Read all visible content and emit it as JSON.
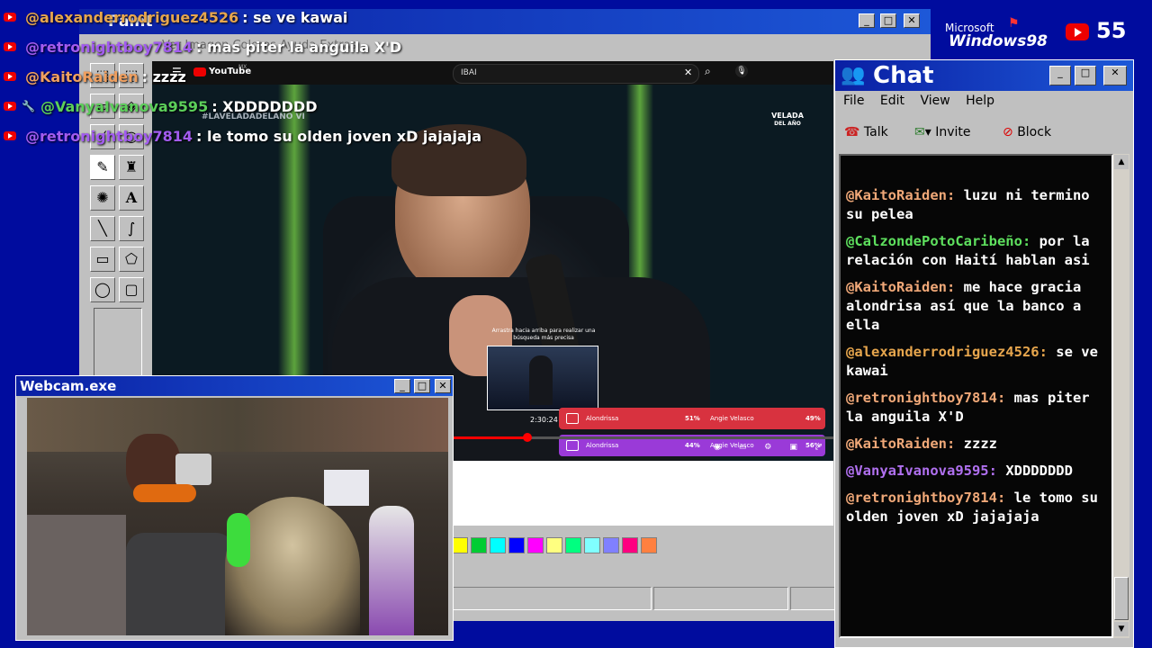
{
  "overlay_chat": [
    {
      "user": "@alexanderrodriguez4526",
      "color": "#e7a64d",
      "text": ": se ve kawai",
      "icon": "youtube-icon"
    },
    {
      "user": "@retronightboy7814",
      "color": "#a35cf0",
      "text": ": mas piter la anguila X'D",
      "icon": "youtube-icon"
    },
    {
      "user": "@KaitoRaiden",
      "color": "#f0a060",
      "text": ": zzzz",
      "icon": "youtube-icon"
    },
    {
      "user": "@VanyaIvanova9595",
      "color": "#5ccf5a",
      "text": ": XDDDDDDD",
      "icon": "youtube-wrench-icon"
    },
    {
      "user": "@retronightboy7814",
      "color": "#a35cf0",
      "text": ": le tomo su olden joven xD jajajaja",
      "icon": "youtube-icon"
    }
  ],
  "os_badge": {
    "vendor": "Microsoft",
    "product": "Windows98",
    "viewers": "55"
  },
  "paint": {
    "title": "Paint",
    "menu_ghost": "Ver  Imagen  Colores  Ayuda  Extras",
    "palette": [
      "#ffff00",
      "#00cc33",
      "#00ffff",
      "#0000ff",
      "#ff00ff",
      "#ffff80",
      "#00ff80",
      "#80ffff",
      "#8080ff",
      "#ff0080",
      "#ff8040"
    ]
  },
  "video": {
    "yt_logo": "YouTube",
    "yt_region": "MX",
    "search_query": "IBAI",
    "hashtag": "#LAVELADADELANO VI",
    "corner_logo_line1": "VELADA",
    "corner_logo_line2": "DEL AÑO",
    "tooltip": "Arrastra hacia arriba para realizar una búsqueda más precisa",
    "timestamp": "2:30:24",
    "polls": [
      {
        "left_name": "Alondrissa",
        "left_pct": "51%",
        "right_name": "Angie Velasco",
        "right_pct": "49%",
        "color": "#d8323f"
      },
      {
        "left_name": "Alondrissa",
        "left_pct": "44%",
        "right_name": "Angie Velasco",
        "right_pct": "56%",
        "color": "#9a3ad8"
      }
    ]
  },
  "webcam": {
    "title": "Webcam.exe"
  },
  "chat": {
    "title": "Chat",
    "menu": [
      "File",
      "Edit",
      "View",
      "Help"
    ],
    "toolbar": {
      "talk": "Talk",
      "invite": "Invite",
      "block": "Block"
    },
    "messages": [
      {
        "user": "@KaitoRaiden:",
        "color": "#f0a878",
        "text": " luzu ni termino su pelea"
      },
      {
        "user": "@CalzondePotoCaribeño:",
        "color": "#5ee05e",
        "text": " por la relación con Haití hablan asi"
      },
      {
        "user": "@KaitoRaiden:",
        "color": "#f0a878",
        "text": " me hace gracia alondrisa así que la banco a ella"
      },
      {
        "user": "@alexanderrodriguez4526:",
        "color": "#e7a64d",
        "text": " se ve kawai"
      },
      {
        "user": "@retronightboy7814:",
        "color": "#f0a878",
        "text": " mas piter la anguila X'D"
      },
      {
        "user": "@KaitoRaiden:",
        "color": "#f0a878",
        "text": " zzzz"
      },
      {
        "user": "@VanyaIvanova9595:",
        "color": "#b070f0",
        "text": " XDDDDDDD"
      },
      {
        "user": "@retronightboy7814:",
        "color": "#f0a878",
        "text": " le tomo su olden joven xD jajajaja"
      }
    ]
  }
}
